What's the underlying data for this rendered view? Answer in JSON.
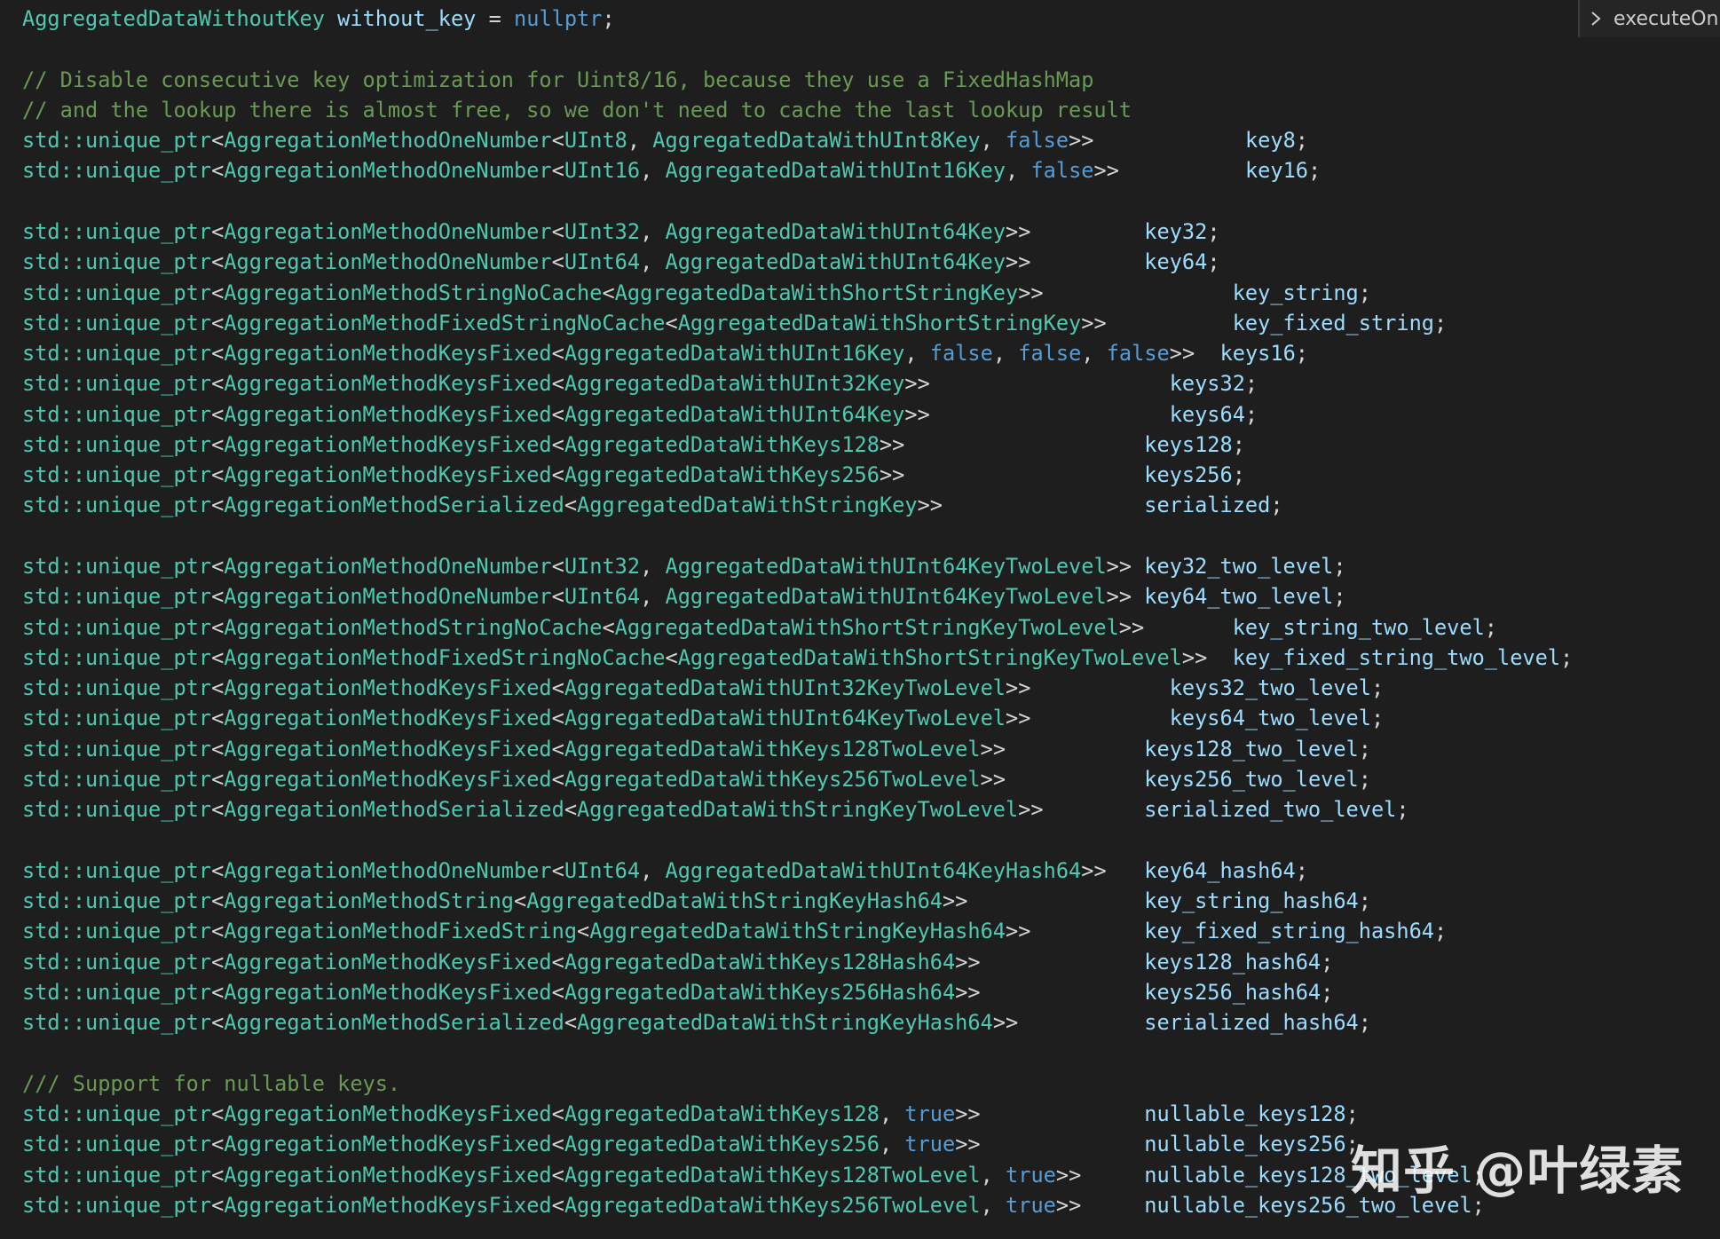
{
  "breadcrumb": {
    "label": "executeOn",
    "icon": "chevron-right-icon"
  },
  "watermark": "知乎 @叶绿素",
  "code_lines": [
    [
      [
        "t",
        "AggregatedDataWithoutKey"
      ],
      [
        "p",
        " "
      ],
      [
        "v",
        "without_key"
      ],
      [
        "p",
        " = "
      ],
      [
        "k",
        "nullptr"
      ],
      [
        "p",
        ";"
      ]
    ],
    [],
    [
      [
        "c",
        "// Disable consecutive key optimization for Uint8/16, because they use a FixedHashMap"
      ]
    ],
    [
      [
        "c",
        "// and the lookup there is almost free, so we don't need to cache the last lookup result"
      ]
    ],
    [
      [
        "t",
        "std::unique_ptr"
      ],
      [
        "p",
        "<"
      ],
      [
        "t",
        "AggregationMethodOneNumber"
      ],
      [
        "p",
        "<"
      ],
      [
        "t",
        "UInt8"
      ],
      [
        "p",
        ", "
      ],
      [
        "t",
        "AggregatedDataWithUInt8Key"
      ],
      [
        "p",
        ", "
      ],
      [
        "k",
        "false"
      ],
      [
        "p",
        ">>            "
      ],
      [
        "v",
        "key8"
      ],
      [
        "p",
        ";"
      ]
    ],
    [
      [
        "t",
        "std::unique_ptr"
      ],
      [
        "p",
        "<"
      ],
      [
        "t",
        "AggregationMethodOneNumber"
      ],
      [
        "p",
        "<"
      ],
      [
        "t",
        "UInt16"
      ],
      [
        "p",
        ", "
      ],
      [
        "t",
        "AggregatedDataWithUInt16Key"
      ],
      [
        "p",
        ", "
      ],
      [
        "k",
        "false"
      ],
      [
        "p",
        ">>          "
      ],
      [
        "v",
        "key16"
      ],
      [
        "p",
        ";"
      ]
    ],
    [],
    [
      [
        "t",
        "std::unique_ptr"
      ],
      [
        "p",
        "<"
      ],
      [
        "t",
        "AggregationMethodOneNumber"
      ],
      [
        "p",
        "<"
      ],
      [
        "t",
        "UInt32"
      ],
      [
        "p",
        ", "
      ],
      [
        "t",
        "AggregatedDataWithUInt64Key"
      ],
      [
        "p",
        ">>         "
      ],
      [
        "v",
        "key32"
      ],
      [
        "p",
        ";"
      ]
    ],
    [
      [
        "t",
        "std::unique_ptr"
      ],
      [
        "p",
        "<"
      ],
      [
        "t",
        "AggregationMethodOneNumber"
      ],
      [
        "p",
        "<"
      ],
      [
        "t",
        "UInt64"
      ],
      [
        "p",
        ", "
      ],
      [
        "t",
        "AggregatedDataWithUInt64Key"
      ],
      [
        "p",
        ">>         "
      ],
      [
        "v",
        "key64"
      ],
      [
        "p",
        ";"
      ]
    ],
    [
      [
        "t",
        "std::unique_ptr"
      ],
      [
        "p",
        "<"
      ],
      [
        "t",
        "AggregationMethodStringNoCache"
      ],
      [
        "p",
        "<"
      ],
      [
        "t",
        "AggregatedDataWithShortStringKey"
      ],
      [
        "p",
        ">>               "
      ],
      [
        "v",
        "key_string"
      ],
      [
        "p",
        ";"
      ]
    ],
    [
      [
        "t",
        "std::unique_ptr"
      ],
      [
        "p",
        "<"
      ],
      [
        "t",
        "AggregationMethodFixedStringNoCache"
      ],
      [
        "p",
        "<"
      ],
      [
        "t",
        "AggregatedDataWithShortStringKey"
      ],
      [
        "p",
        ">>          "
      ],
      [
        "v",
        "key_fixed_string"
      ],
      [
        "p",
        ";"
      ]
    ],
    [
      [
        "t",
        "std::unique_ptr"
      ],
      [
        "p",
        "<"
      ],
      [
        "t",
        "AggregationMethodKeysFixed"
      ],
      [
        "p",
        "<"
      ],
      [
        "t",
        "AggregatedDataWithUInt16Key"
      ],
      [
        "p",
        ", "
      ],
      [
        "k",
        "false"
      ],
      [
        "p",
        ", "
      ],
      [
        "k",
        "false"
      ],
      [
        "p",
        ", "
      ],
      [
        "k",
        "false"
      ],
      [
        "p",
        ">>  "
      ],
      [
        "v",
        "keys16"
      ],
      [
        "p",
        ";"
      ]
    ],
    [
      [
        "t",
        "std::unique_ptr"
      ],
      [
        "p",
        "<"
      ],
      [
        "t",
        "AggregationMethodKeysFixed"
      ],
      [
        "p",
        "<"
      ],
      [
        "t",
        "AggregatedDataWithUInt32Key"
      ],
      [
        "p",
        ">>                   "
      ],
      [
        "v",
        "keys32"
      ],
      [
        "p",
        ";"
      ]
    ],
    [
      [
        "t",
        "std::unique_ptr"
      ],
      [
        "p",
        "<"
      ],
      [
        "t",
        "AggregationMethodKeysFixed"
      ],
      [
        "p",
        "<"
      ],
      [
        "t",
        "AggregatedDataWithUInt64Key"
      ],
      [
        "p",
        ">>                   "
      ],
      [
        "v",
        "keys64"
      ],
      [
        "p",
        ";"
      ]
    ],
    [
      [
        "t",
        "std::unique_ptr"
      ],
      [
        "p",
        "<"
      ],
      [
        "t",
        "AggregationMethodKeysFixed"
      ],
      [
        "p",
        "<"
      ],
      [
        "t",
        "AggregatedDataWithKeys128"
      ],
      [
        "p",
        ">>                   "
      ],
      [
        "v",
        "keys128"
      ],
      [
        "p",
        ";"
      ]
    ],
    [
      [
        "t",
        "std::unique_ptr"
      ],
      [
        "p",
        "<"
      ],
      [
        "t",
        "AggregationMethodKeysFixed"
      ],
      [
        "p",
        "<"
      ],
      [
        "t",
        "AggregatedDataWithKeys256"
      ],
      [
        "p",
        ">>                   "
      ],
      [
        "v",
        "keys256"
      ],
      [
        "p",
        ";"
      ]
    ],
    [
      [
        "t",
        "std::unique_ptr"
      ],
      [
        "p",
        "<"
      ],
      [
        "t",
        "AggregationMethodSerialized"
      ],
      [
        "p",
        "<"
      ],
      [
        "t",
        "AggregatedDataWithStringKey"
      ],
      [
        "p",
        ">>                "
      ],
      [
        "v",
        "serialized"
      ],
      [
        "p",
        ";"
      ]
    ],
    [],
    [
      [
        "t",
        "std::unique_ptr"
      ],
      [
        "p",
        "<"
      ],
      [
        "t",
        "AggregationMethodOneNumber"
      ],
      [
        "p",
        "<"
      ],
      [
        "t",
        "UInt32"
      ],
      [
        "p",
        ", "
      ],
      [
        "t",
        "AggregatedDataWithUInt64KeyTwoLevel"
      ],
      [
        "p",
        ">> "
      ],
      [
        "v",
        "key32_two_level"
      ],
      [
        "p",
        ";"
      ]
    ],
    [
      [
        "t",
        "std::unique_ptr"
      ],
      [
        "p",
        "<"
      ],
      [
        "t",
        "AggregationMethodOneNumber"
      ],
      [
        "p",
        "<"
      ],
      [
        "t",
        "UInt64"
      ],
      [
        "p",
        ", "
      ],
      [
        "t",
        "AggregatedDataWithUInt64KeyTwoLevel"
      ],
      [
        "p",
        ">> "
      ],
      [
        "v",
        "key64_two_level"
      ],
      [
        "p",
        ";"
      ]
    ],
    [
      [
        "t",
        "std::unique_ptr"
      ],
      [
        "p",
        "<"
      ],
      [
        "t",
        "AggregationMethodStringNoCache"
      ],
      [
        "p",
        "<"
      ],
      [
        "t",
        "AggregatedDataWithShortStringKeyTwoLevel"
      ],
      [
        "p",
        ">>       "
      ],
      [
        "v",
        "key_string_two_level"
      ],
      [
        "p",
        ";"
      ]
    ],
    [
      [
        "t",
        "std::unique_ptr"
      ],
      [
        "p",
        "<"
      ],
      [
        "t",
        "AggregationMethodFixedStringNoCache"
      ],
      [
        "p",
        "<"
      ],
      [
        "t",
        "AggregatedDataWithShortStringKeyTwoLevel"
      ],
      [
        "p",
        ">>  "
      ],
      [
        "v",
        "key_fixed_string_two_level"
      ],
      [
        "p",
        ";"
      ]
    ],
    [
      [
        "t",
        "std::unique_ptr"
      ],
      [
        "p",
        "<"
      ],
      [
        "t",
        "AggregationMethodKeysFixed"
      ],
      [
        "p",
        "<"
      ],
      [
        "t",
        "AggregatedDataWithUInt32KeyTwoLevel"
      ],
      [
        "p",
        ">>           "
      ],
      [
        "v",
        "keys32_two_level"
      ],
      [
        "p",
        ";"
      ]
    ],
    [
      [
        "t",
        "std::unique_ptr"
      ],
      [
        "p",
        "<"
      ],
      [
        "t",
        "AggregationMethodKeysFixed"
      ],
      [
        "p",
        "<"
      ],
      [
        "t",
        "AggregatedDataWithUInt64KeyTwoLevel"
      ],
      [
        "p",
        ">>           "
      ],
      [
        "v",
        "keys64_two_level"
      ],
      [
        "p",
        ";"
      ]
    ],
    [
      [
        "t",
        "std::unique_ptr"
      ],
      [
        "p",
        "<"
      ],
      [
        "t",
        "AggregationMethodKeysFixed"
      ],
      [
        "p",
        "<"
      ],
      [
        "t",
        "AggregatedDataWithKeys128TwoLevel"
      ],
      [
        "p",
        ">>           "
      ],
      [
        "v",
        "keys128_two_level"
      ],
      [
        "p",
        ";"
      ]
    ],
    [
      [
        "t",
        "std::unique_ptr"
      ],
      [
        "p",
        "<"
      ],
      [
        "t",
        "AggregationMethodKeysFixed"
      ],
      [
        "p",
        "<"
      ],
      [
        "t",
        "AggregatedDataWithKeys256TwoLevel"
      ],
      [
        "p",
        ">>           "
      ],
      [
        "v",
        "keys256_two_level"
      ],
      [
        "p",
        ";"
      ]
    ],
    [
      [
        "t",
        "std::unique_ptr"
      ],
      [
        "p",
        "<"
      ],
      [
        "t",
        "AggregationMethodSerialized"
      ],
      [
        "p",
        "<"
      ],
      [
        "t",
        "AggregatedDataWithStringKeyTwoLevel"
      ],
      [
        "p",
        ">>        "
      ],
      [
        "v",
        "serialized_two_level"
      ],
      [
        "p",
        ";"
      ]
    ],
    [],
    [
      [
        "t",
        "std::unique_ptr"
      ],
      [
        "p",
        "<"
      ],
      [
        "t",
        "AggregationMethodOneNumber"
      ],
      [
        "p",
        "<"
      ],
      [
        "t",
        "UInt64"
      ],
      [
        "p",
        ", "
      ],
      [
        "t",
        "AggregatedDataWithUInt64KeyHash64"
      ],
      [
        "p",
        ">>   "
      ],
      [
        "v",
        "key64_hash64"
      ],
      [
        "p",
        ";"
      ]
    ],
    [
      [
        "t",
        "std::unique_ptr"
      ],
      [
        "p",
        "<"
      ],
      [
        "t",
        "AggregationMethodString"
      ],
      [
        "p",
        "<"
      ],
      [
        "t",
        "AggregatedDataWithStringKeyHash64"
      ],
      [
        "p",
        ">>              "
      ],
      [
        "v",
        "key_string_hash64"
      ],
      [
        "p",
        ";"
      ]
    ],
    [
      [
        "t",
        "std::unique_ptr"
      ],
      [
        "p",
        "<"
      ],
      [
        "t",
        "AggregationMethodFixedString"
      ],
      [
        "p",
        "<"
      ],
      [
        "t",
        "AggregatedDataWithStringKeyHash64"
      ],
      [
        "p",
        ">>         "
      ],
      [
        "v",
        "key_fixed_string_hash64"
      ],
      [
        "p",
        ";"
      ]
    ],
    [
      [
        "t",
        "std::unique_ptr"
      ],
      [
        "p",
        "<"
      ],
      [
        "t",
        "AggregationMethodKeysFixed"
      ],
      [
        "p",
        "<"
      ],
      [
        "t",
        "AggregatedDataWithKeys128Hash64"
      ],
      [
        "p",
        ">>             "
      ],
      [
        "v",
        "keys128_hash64"
      ],
      [
        "p",
        ";"
      ]
    ],
    [
      [
        "t",
        "std::unique_ptr"
      ],
      [
        "p",
        "<"
      ],
      [
        "t",
        "AggregationMethodKeysFixed"
      ],
      [
        "p",
        "<"
      ],
      [
        "t",
        "AggregatedDataWithKeys256Hash64"
      ],
      [
        "p",
        ">>             "
      ],
      [
        "v",
        "keys256_hash64"
      ],
      [
        "p",
        ";"
      ]
    ],
    [
      [
        "t",
        "std::unique_ptr"
      ],
      [
        "p",
        "<"
      ],
      [
        "t",
        "AggregationMethodSerialized"
      ],
      [
        "p",
        "<"
      ],
      [
        "t",
        "AggregatedDataWithStringKeyHash64"
      ],
      [
        "p",
        ">>          "
      ],
      [
        "v",
        "serialized_hash64"
      ],
      [
        "p",
        ";"
      ]
    ],
    [],
    [
      [
        "c",
        "/// Support for nullable keys."
      ]
    ],
    [
      [
        "t",
        "std::unique_ptr"
      ],
      [
        "p",
        "<"
      ],
      [
        "t",
        "AggregationMethodKeysFixed"
      ],
      [
        "p",
        "<"
      ],
      [
        "t",
        "AggregatedDataWithKeys128"
      ],
      [
        "p",
        ", "
      ],
      [
        "k",
        "true"
      ],
      [
        "p",
        ">>             "
      ],
      [
        "v",
        "nullable_keys128"
      ],
      [
        "p",
        ";"
      ]
    ],
    [
      [
        "t",
        "std::unique_ptr"
      ],
      [
        "p",
        "<"
      ],
      [
        "t",
        "AggregationMethodKeysFixed"
      ],
      [
        "p",
        "<"
      ],
      [
        "t",
        "AggregatedDataWithKeys256"
      ],
      [
        "p",
        ", "
      ],
      [
        "k",
        "true"
      ],
      [
        "p",
        ">>             "
      ],
      [
        "v",
        "nullable_keys256"
      ],
      [
        "p",
        ";"
      ]
    ],
    [
      [
        "t",
        "std::unique_ptr"
      ],
      [
        "p",
        "<"
      ],
      [
        "t",
        "AggregationMethodKeysFixed"
      ],
      [
        "p",
        "<"
      ],
      [
        "t",
        "AggregatedDataWithKeys128TwoLevel"
      ],
      [
        "p",
        ", "
      ],
      [
        "k",
        "true"
      ],
      [
        "p",
        ">>     "
      ],
      [
        "v",
        "nullable_keys128_two_level"
      ],
      [
        "p",
        ";"
      ]
    ],
    [
      [
        "t",
        "std::unique_ptr"
      ],
      [
        "p",
        "<"
      ],
      [
        "t",
        "AggregationMethodKeysFixed"
      ],
      [
        "p",
        "<"
      ],
      [
        "t",
        "AggregatedDataWithKeys256TwoLevel"
      ],
      [
        "p",
        ", "
      ],
      [
        "k",
        "true"
      ],
      [
        "p",
        ">>     "
      ],
      [
        "v",
        "nullable_keys256_two_level"
      ],
      [
        "p",
        ";"
      ]
    ]
  ]
}
